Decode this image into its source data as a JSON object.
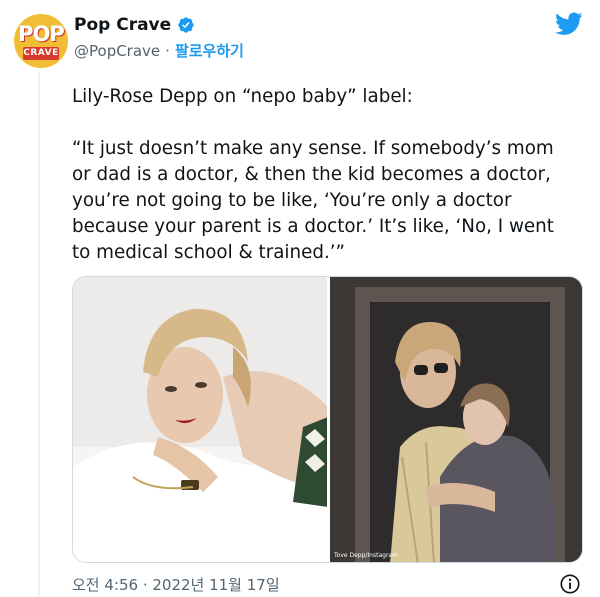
{
  "tweet": {
    "avatar_logo": {
      "top": "POP",
      "bottom": "CRAVE"
    },
    "display_name": "Pop Crave",
    "handle": "@PopCrave",
    "separator": "·",
    "follow_label": "팔로우하기",
    "text_lines": [
      "Lily-Rose Depp on “nepo baby” label:",
      "",
      "“It just doesn’t make any sense. If somebody’s mom",
      "or dad is a doctor, & then the kid becomes a doctor,",
      "you’re not going to be like, ‘You’re only a doctor",
      "because your parent is a doctor.’ It’s like, ‘No, I went",
      "to medical school & trained.’”"
    ],
    "media": {
      "right_photo_credit": "Tove Depp/Instagram"
    },
    "timestamp": "오전 4:56 · 2022년 11월 17일"
  },
  "icons": {
    "verified": "verified-badge-icon",
    "brand": "twitter-bird-icon",
    "info": "info-icon"
  },
  "colors": {
    "accent": "#1d9bf0",
    "secondary_text": "#536471",
    "primary_text": "#0f1419",
    "avatar_bg": "#f1bd34",
    "avatar_red": "#d9392f"
  }
}
